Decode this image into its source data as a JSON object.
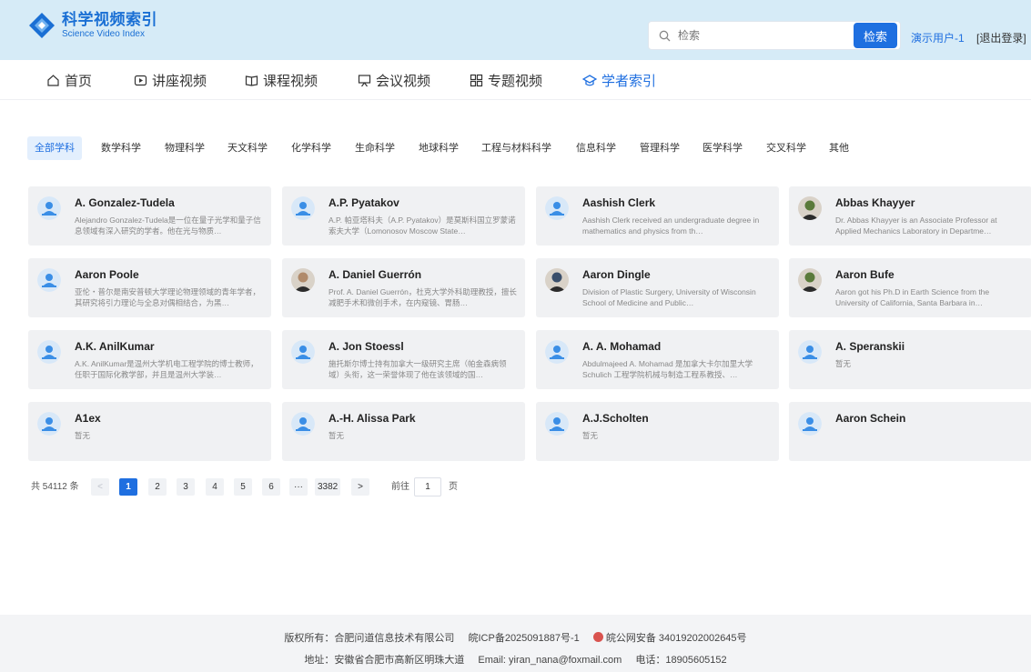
{
  "header": {
    "logo_cn": "科学视频索引",
    "logo_en": "Science Video Index",
    "search_placeholder": "检索",
    "search_button": "检索",
    "user": "演示用户-1",
    "logout": "[退出登录]"
  },
  "nav": [
    {
      "label": "首页",
      "icon": "home-icon"
    },
    {
      "label": "讲座视频",
      "icon": "play-icon"
    },
    {
      "label": "课程视频",
      "icon": "book-icon"
    },
    {
      "label": "会议视频",
      "icon": "presentation-icon"
    },
    {
      "label": "专题视频",
      "icon": "grid-icon"
    },
    {
      "label": "学者索引",
      "icon": "scholar-cap-icon",
      "active": true
    }
  ],
  "categories": [
    "全部学科",
    "数学科学",
    "物理科学",
    "天文科学",
    "化学科学",
    "生命科学",
    "地球科学",
    "工程与材料科学",
    "信息科学",
    "管理科学",
    "医学科学",
    "交叉科学",
    "其他"
  ],
  "scholars": [
    {
      "name": "A. Gonzalez-Tudela",
      "desc": "Alejandro Gonzalez-Tudela是一位在量子光学和量子信息领域有深入研究的学者。他在光与物质…",
      "avatar": "default"
    },
    {
      "name": "A.P. Pyatakov",
      "desc": "A.P. 帕亚塔科夫（A.P. Pyatakov）是莫斯科国立罗蒙诺索夫大学（Lomonosov Moscow State…",
      "avatar": "default"
    },
    {
      "name": "Aashish Clerk",
      "desc": "Aashish Clerk received an undergraduate degree in mathematics and physics from th…",
      "avatar": "default"
    },
    {
      "name": "Abbas Khayyer",
      "desc": "Dr. Abbas Khayyer is an Associate Professor at Applied Mechanics Laboratory in Departme…",
      "avatar": "photo"
    },
    {
      "name": "Aaron Poole",
      "desc": "亚伦・普尔是南安普顿大学理论物理领域的青年学者，其研究将引力理论与全息对偶相结合，为黑…",
      "avatar": "default"
    },
    {
      "name": "A. Daniel Guerrón",
      "desc": "Prof. A. Daniel Guerrón，杜克大学外科助理教授，擅长减肥手术和微创手术，在内窥镜、胃肠…",
      "avatar": "photo"
    },
    {
      "name": "Aaron Dingle",
      "desc": "Division of Plastic Surgery, University of Wisconsin School of Medicine and Public…",
      "avatar": "photo"
    },
    {
      "name": "Aaron Bufe",
      "desc": "Aaron got his Ph.D in Earth Science from the University of California, Santa Barbara in…",
      "avatar": "photo"
    },
    {
      "name": "A.K. AnilKumar",
      "desc": "A.K. AnilKumar是温州大学机电工程学院的博士教师，任职于国际化教学部，并且是温州大学装…",
      "avatar": "default"
    },
    {
      "name": "A. Jon Stoessl",
      "desc": "施托斯尔博士持有加拿大一级研究主席（帕金森病领域）头衔，这一荣誉体现了他在该领域的国…",
      "avatar": "default"
    },
    {
      "name": "A. A. Mohamad",
      "desc": "Abdulmajeed A. Mohamad 是加拿大卡尔加里大学 Schulich 工程学院机械与制造工程系教授、…",
      "avatar": "default"
    },
    {
      "name": "A. Speranskii",
      "desc": "暂无",
      "avatar": "default"
    },
    {
      "name": "A1ex",
      "desc": "暂无",
      "avatar": "default"
    },
    {
      "name": "A.-H. Alissa Park",
      "desc": "暂无",
      "avatar": "default"
    },
    {
      "name": "A.J.Scholten",
      "desc": "暂无",
      "avatar": "default"
    },
    {
      "name": "Aaron Schein",
      "desc": "",
      "avatar": "default"
    }
  ],
  "pagination": {
    "total": "共 54112 条",
    "prev": "<",
    "pages": [
      "1",
      "2",
      "3",
      "4",
      "5",
      "6",
      "···",
      "3382"
    ],
    "next": ">",
    "goto_label": "前往",
    "goto_value": "1",
    "page_unit": "页"
  },
  "footer": {
    "copyright": "版权所有：合肥问道信息技术有限公司",
    "icp": "皖ICP备2025091887号-1",
    "police": "皖公网安备 34019202002645号",
    "address": "地址：安徽省合肥市高新区明珠大道",
    "email": "Email: yiran_nana@foxmail.com",
    "phone": "电话：18905605152"
  },
  "colors": {
    "accent": "#1f6fe0",
    "header_bg": "#d6ebf7",
    "card_bg": "#f0f1f3"
  }
}
